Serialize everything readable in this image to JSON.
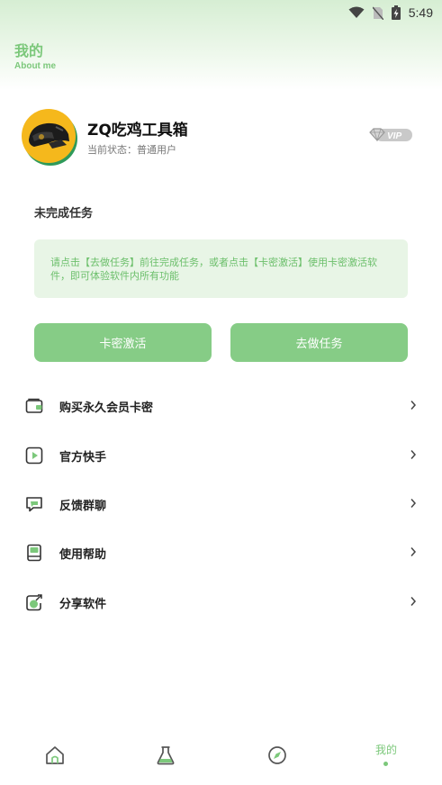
{
  "status_bar": {
    "time": "5:49"
  },
  "header": {
    "title": "我的",
    "subtitle": "About me"
  },
  "profile": {
    "name": "ZQ吃鸡工具箱",
    "status": "当前状态：普通用户",
    "badge": "VIP"
  },
  "task": {
    "title": "未完成任务",
    "notice": "请点击【去做任务】前往完成任务，或者点击【卡密激活】使用卡密激活软件，即可体验软件内所有功能"
  },
  "buttons": {
    "activate": "卡密激活",
    "do_task": "去做任务"
  },
  "menu": {
    "items": [
      {
        "label": "购买永久会员卡密",
        "icon": "wallet-icon"
      },
      {
        "label": "官方快手",
        "icon": "video-play-icon"
      },
      {
        "label": "反馈群聊",
        "icon": "chat-icon"
      },
      {
        "label": "使用帮助",
        "icon": "book-icon"
      },
      {
        "label": "分享软件",
        "icon": "share-icon"
      }
    ]
  },
  "tabbar": {
    "tabs": [
      {
        "icon": "home-icon"
      },
      {
        "icon": "flask-icon"
      },
      {
        "icon": "compass-icon"
      },
      {
        "label": "我的",
        "active": true
      }
    ]
  },
  "colors": {
    "accent": "#7cc87b",
    "button": "#86cc86",
    "notice_bg": "#e8f5e6",
    "avatar_bg": "#f5b81c"
  }
}
